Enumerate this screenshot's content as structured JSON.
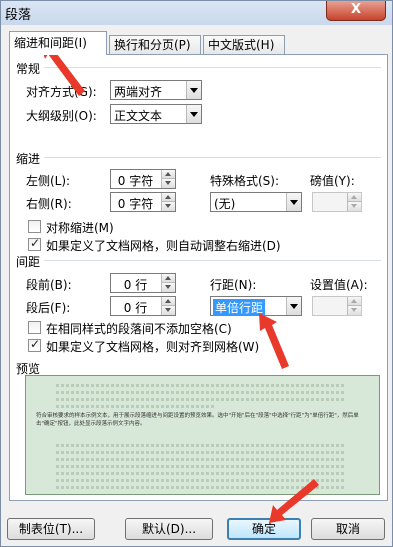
{
  "window": {
    "title": "段落",
    "close": "X"
  },
  "tabs": [
    {
      "label": "缩进和间距(I)"
    },
    {
      "label": "换行和分页(P)"
    },
    {
      "label": "中文版式(H)"
    }
  ],
  "general": {
    "section": "常规",
    "alignment_label": "对齐方式(G):",
    "alignment_value": "两端对齐",
    "outline_label": "大纲级别(O):",
    "outline_value": "正文文本"
  },
  "indent": {
    "section": "缩进",
    "left_label": "左侧(L):",
    "left_value": "0 字符",
    "right_label": "右侧(R):",
    "right_value": "0 字符",
    "special_label": "特殊格式(S):",
    "special_value": "(无)",
    "by_label": "磅值(Y):",
    "by_value": "",
    "mirror_label": "对称缩进(M)",
    "mirror_checked": false,
    "auto_adjust_label": "如果定义了文档网格，则自动调整右缩进(D)",
    "auto_adjust_checked": true
  },
  "spacing": {
    "section": "间距",
    "before_label": "段前(B):",
    "before_value": "0 行",
    "after_label": "段后(F):",
    "after_value": "0 行",
    "line_spacing_label": "行距(N):",
    "line_spacing_value": "单倍行距",
    "at_label": "设置值(A):",
    "at_value": "",
    "no_space_label": "在相同样式的段落间不添加空格(C)",
    "no_space_checked": false,
    "snap_grid_label": "如果定义了文档网格，则对齐到网格(W)",
    "snap_grid_checked": true
  },
  "preview": {
    "section": "预览",
    "sample_text": "符合审核要求的样本示例文本，用于展示段落缩进与间距设置的预览效果。选中\"开始\"后在\"段落\"中选择\"行距\"为\"单倍行距\"，然后单击\"确定\"按钮，此处显示段落示例文字内容。"
  },
  "buttons": {
    "tabs": "制表位(T)...",
    "default": "默认(D)...",
    "ok": "确定",
    "cancel": "取消"
  }
}
